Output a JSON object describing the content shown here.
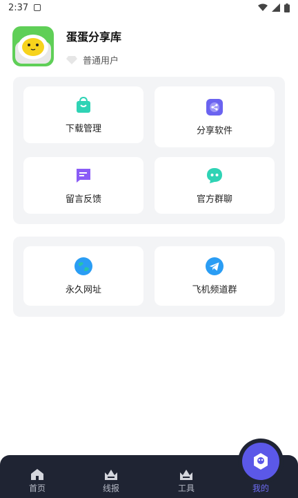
{
  "status_bar": {
    "time": "2:37"
  },
  "profile": {
    "username": "蛋蛋分享库",
    "role": "普通用户"
  },
  "panel_1": {
    "items": [
      {
        "label": "下载管理",
        "icon": "shopping-bag-icon",
        "color": "#2fd3b5"
      },
      {
        "label": "分享软件",
        "icon": "share-icon",
        "color": "#6a63f0"
      },
      {
        "label": "留言反馈",
        "icon": "message-icon",
        "color": "#8a5cf6"
      },
      {
        "label": "官方群聊",
        "icon": "chat-bot-icon",
        "color": "#2fd3b5"
      }
    ]
  },
  "panel_2": {
    "items": [
      {
        "label": "永久网址",
        "icon": "globe-icon",
        "color": "#2a9df4"
      },
      {
        "label": "飞机频道群",
        "icon": "telegram-icon",
        "color": "#2a9df4"
      }
    ]
  },
  "bottom_nav": {
    "items": [
      {
        "label": "首页",
        "icon": "home-icon"
      },
      {
        "label": "线报",
        "icon": "crown-icon"
      },
      {
        "label": "工具",
        "icon": "crown-icon"
      },
      {
        "label": "我的",
        "icon": "profile-icon"
      }
    ],
    "active_index": 3,
    "colors": {
      "background": "#1f2433",
      "active": "#6e6cf5",
      "inactive": "#b6bac6"
    }
  }
}
